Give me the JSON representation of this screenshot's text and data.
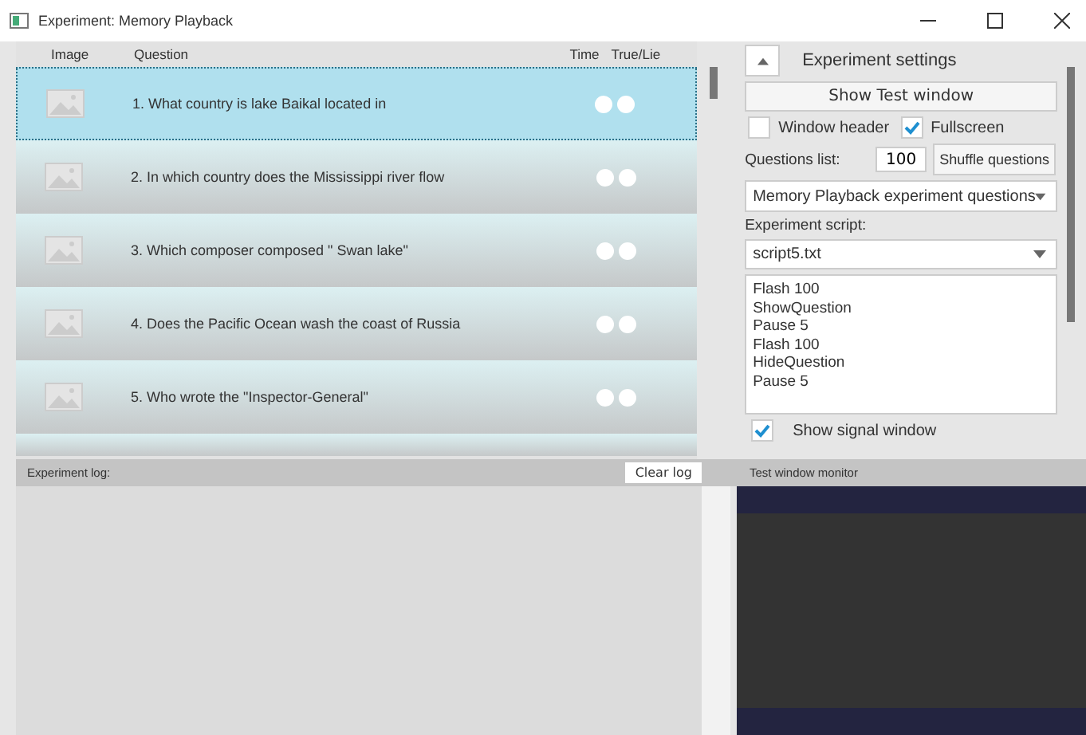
{
  "window": {
    "title": "Experiment: Memory Playback"
  },
  "table": {
    "columns": [
      "Image",
      "Question",
      "Time",
      "True/Lie"
    ],
    "rows": [
      {
        "question": "1. What country is lake Baikal located in",
        "selected": true
      },
      {
        "question": "2. In which country does the Mississippi river flow",
        "selected": false
      },
      {
        "question": "3. Which composer composed \" Swan lake\"",
        "selected": false
      },
      {
        "question": "4. Does the Pacific Ocean wash the coast of Russia",
        "selected": false
      },
      {
        "question": "5. Who wrote the \"Inspector-General\"",
        "selected": false
      }
    ]
  },
  "settings": {
    "title": "Experiment settings",
    "expanded": true,
    "show_button": "Show Test window",
    "window_header": {
      "label": "Window header",
      "checked": false
    },
    "fullscreen": {
      "label": "Fullscreen",
      "checked": true
    },
    "questions_label": "Questions list:",
    "questions_count": "100",
    "shuffle_button": "Shuffle questions",
    "questions_select": "Memory Playback experiment questions",
    "script_label": "Experiment script:",
    "script_select": "script5.txt",
    "script_lines": [
      "Flash 100",
      "ShowQuestion",
      "Pause 5",
      "Flash 100",
      "HideQuestion",
      "Pause 5"
    ],
    "signal_window": {
      "label": "Show signal window",
      "checked": true
    }
  },
  "log": {
    "label": "Experiment log:",
    "clear_button": "Clear log"
  },
  "monitor": {
    "label": "Test window monitor"
  }
}
